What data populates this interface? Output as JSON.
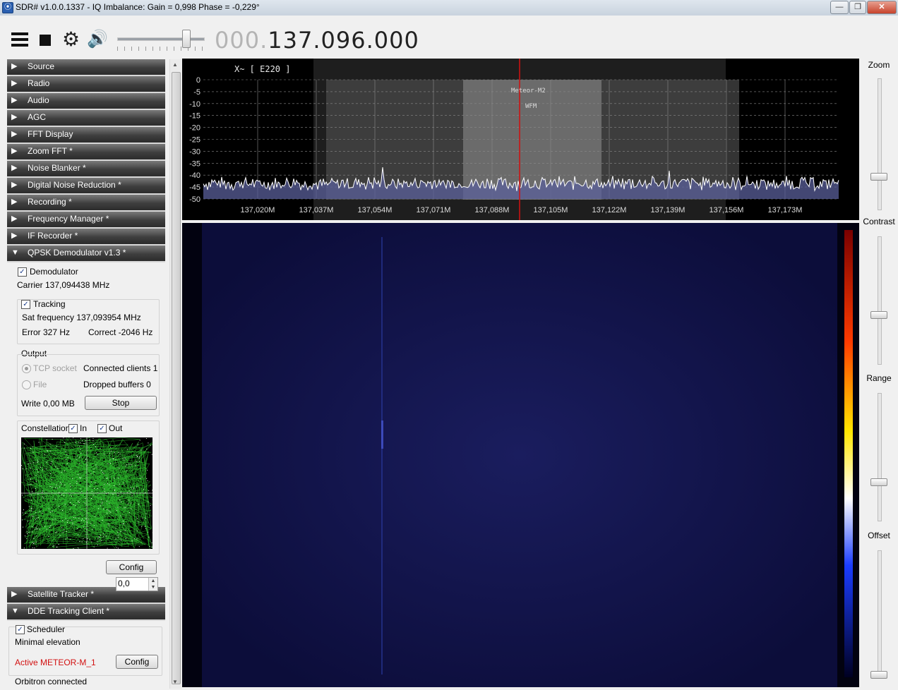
{
  "window": {
    "title": "SDR# v1.0.0.1337 - IQ Imbalance: Gain = 0,998 Phase = -0,229°",
    "minimize": "—",
    "maximize": "❐",
    "close": "✕"
  },
  "toolbar": {
    "freq_prefix": "000.",
    "freq_main": "137.096.000",
    "volume_level": 0.82
  },
  "sections_top": [
    {
      "label": "Source",
      "expanded": false
    },
    {
      "label": "Radio",
      "expanded": false
    },
    {
      "label": "Audio",
      "expanded": false
    },
    {
      "label": "AGC",
      "expanded": false
    },
    {
      "label": "FFT Display",
      "expanded": false
    },
    {
      "label": "Zoom FFT *",
      "expanded": false
    },
    {
      "label": "Noise Blanker *",
      "expanded": false
    },
    {
      "label": "Digital Noise Reduction *",
      "expanded": false
    },
    {
      "label": "Recording *",
      "expanded": false
    },
    {
      "label": "Frequency Manager *",
      "expanded": false
    },
    {
      "label": "IF Recorder *",
      "expanded": false
    },
    {
      "label": "QPSK Demodulator v1.3 *",
      "expanded": true
    }
  ],
  "arrows": {
    "collapsed": "▶",
    "expanded": "▼"
  },
  "qpsk": {
    "demodulator_label": "Demodulator",
    "carrier": "Carrier 137,094438 MHz",
    "tracking_label": "Tracking",
    "sat_frequency": "Sat frequency 137,093954 MHz",
    "error": "Error 327 Hz",
    "correct": "Correct -2046 Hz",
    "output_label": "Output",
    "tcp_socket": "TCP socket",
    "connected_clients": "Connected clients 1",
    "file": "File",
    "dropped_buffers": "Dropped buffers 0",
    "write": "Write 0,00 MB",
    "stop_button": "Stop",
    "constellation_label": "Constellation",
    "in_label": "In",
    "out_label": "Out",
    "config_button": "Config"
  },
  "sections_bottom": [
    {
      "label": "Satellite Tracker *",
      "expanded": false
    },
    {
      "label": "DDE Tracking Client *",
      "expanded": true
    }
  ],
  "dde": {
    "scheduler_label": "Scheduler",
    "minimal_elevation_label": "Minimal elevation",
    "minimal_elevation_value": "0,0",
    "active": "Active METEOR-M_1",
    "config_button": "Config",
    "status": "Orbitron connected"
  },
  "checkmark": "✓",
  "spectrum": {
    "header": "X~ [ E220 ]",
    "station_name": "Meteor-M2",
    "mode": "WFM",
    "y_ticks": [
      "0",
      "-5",
      "-10",
      "-15",
      "-20",
      "-25",
      "-30",
      "-35",
      "-40",
      "-45",
      "-50"
    ],
    "x_ticks": [
      "137,020M",
      "137,037M",
      "137,054M",
      "137,071M",
      "137,088M",
      "137,105M",
      "137,122M",
      "137,139M",
      "137,156M",
      "137,173M"
    ]
  },
  "right_panel": {
    "zoom_label": "Zoom",
    "contrast_label": "Contrast",
    "range_label": "Range",
    "offset_label": "Offset"
  },
  "colors": {
    "waterfall_bg": "#0a0b35",
    "accent_red": "#d21010",
    "constellation_green": "#2bb52b"
  }
}
